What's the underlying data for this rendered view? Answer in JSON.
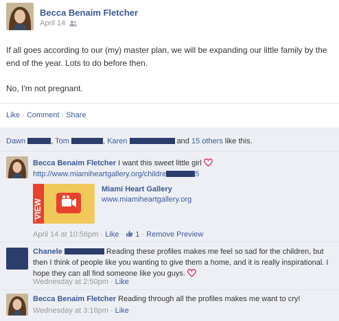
{
  "post": {
    "author": "Becca Benaim Fletcher",
    "date": "April 14",
    "body": [
      "If all goes according to our (my) master plan, we will be expanding our little family by the end of the year. Lots to do before then.",
      "No, I'm not pregnant."
    ],
    "actions": {
      "like": "Like",
      "comment": "Comment",
      "share": "Share"
    }
  },
  "likes": {
    "person1": "Dawn",
    "person2": "Tom",
    "person3": "Karen",
    "and": "and",
    "others": "15 others",
    "suffix": "like this."
  },
  "comments": [
    {
      "author": "Becca Benaim Fletcher",
      "text": "I want this sweet little girl",
      "url": "http://www.miamiheartgallery.org/childre",
      "url_tail": "5",
      "share_title": "Miami Heart Gallery",
      "share_url": "www.miamiheartgallery.org",
      "thumb_label": "VIEW",
      "thumb_sub": "VIDEO",
      "time": "April 14 at 10:56pm",
      "like": "Like",
      "like_count": "1",
      "remove_preview": "Remove Preview"
    },
    {
      "author": "Chanele",
      "text": "Reading these profiles makes me feel so sad for the children, but then I think of people like you wanting to give them a home, and it is really inspirational. I hope they can all find someone like you guys.",
      "time": "Wednesday at 2:50pm",
      "like": "Like"
    },
    {
      "author": "Becca Benaim Fletcher",
      "text": "Reading through all the profiles makes me want to cry!",
      "time": "Wednesday at 3:16pm",
      "like": "Like"
    }
  ],
  "colors": {
    "link": "#3b5998",
    "ufi_bg": "#edeff4",
    "heart": "#e0245e",
    "thumb": "#e8422e"
  }
}
